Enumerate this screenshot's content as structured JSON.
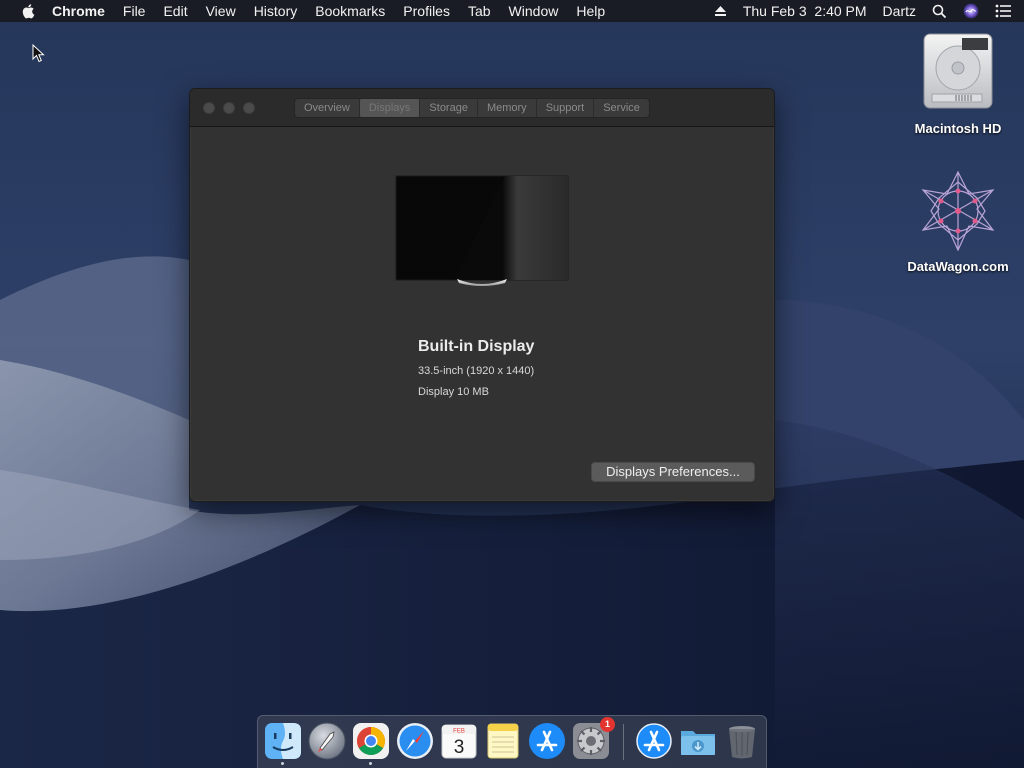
{
  "menubar": {
    "apple_icon": "apple-icon",
    "app_name": "Chrome",
    "menus": [
      "File",
      "Edit",
      "View",
      "History",
      "Bookmarks",
      "Profiles",
      "Tab",
      "Window",
      "Help"
    ],
    "status": {
      "eject_icon": "eject-icon",
      "datetime": "Thu Feb 3  2:40 PM",
      "user": "Dartz",
      "search_icon": "spotlight-search-icon",
      "siri_icon": "siri-icon",
      "notification_icon": "notification-center-icon"
    }
  },
  "desktop": {
    "icons": [
      {
        "label": "Macintosh HD",
        "icon": "hard-drive-icon"
      },
      {
        "label": "DataWagon.com",
        "icon": "datawagon-logo-icon"
      }
    ]
  },
  "window": {
    "tabs": [
      "Overview",
      "Displays",
      "Storage",
      "Memory",
      "Support",
      "Service"
    ],
    "active_tab": "Displays",
    "display": {
      "name": "Built-in Display",
      "size": "33.5-inch (1920 x 1440)",
      "memory": "Display 10 MB"
    },
    "button_label": "Displays Preferences..."
  },
  "dock": {
    "apps": [
      {
        "name": "Finder",
        "icon": "finder-icon",
        "running": true
      },
      {
        "name": "Launchpad",
        "icon": "launchpad-icon",
        "running": false
      },
      {
        "name": "Google Chrome",
        "icon": "chrome-icon",
        "running": true
      },
      {
        "name": "Safari",
        "icon": "safari-icon",
        "running": false
      },
      {
        "name": "Calendar",
        "icon": "calendar-icon",
        "running": false,
        "calendar_month": "FEB",
        "calendar_day": "3"
      },
      {
        "name": "Notes",
        "icon": "notes-icon",
        "running": false
      },
      {
        "name": "App Store",
        "icon": "app-store-icon",
        "running": false
      },
      {
        "name": "System Preferences",
        "icon": "system-preferences-icon",
        "running": false,
        "badge": "1"
      },
      {
        "name": "App Store",
        "icon": "app-store-icon",
        "running": false
      },
      {
        "name": "Downloads",
        "icon": "downloads-folder-icon",
        "running": false
      },
      {
        "name": "Trash",
        "icon": "trash-icon",
        "running": false
      }
    ]
  },
  "colors": {
    "wallpaper_top": "#1c2a4a",
    "wallpaper_bottom": "#101a33",
    "window_bg": "#323232",
    "titlebar_bg": "#2b2b2b",
    "badge": "#e3342f"
  }
}
